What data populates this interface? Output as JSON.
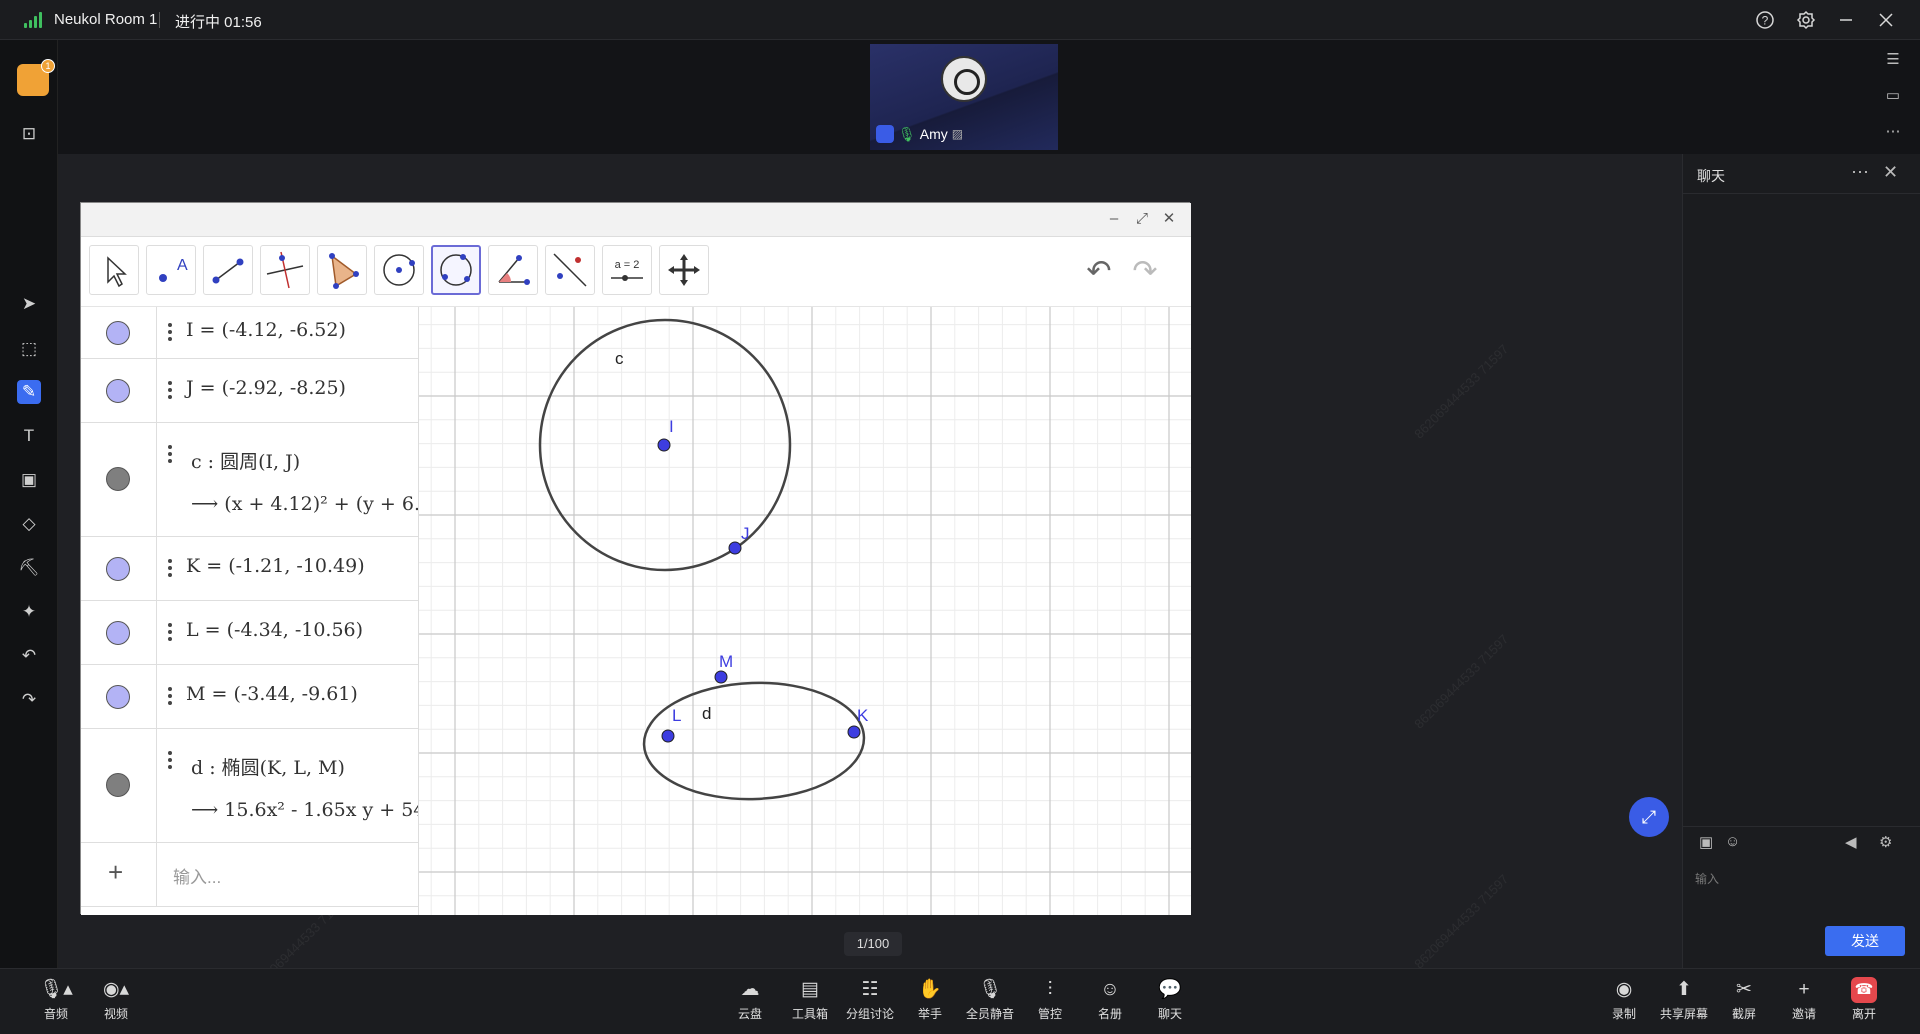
{
  "titlebar": {
    "room": "Neukol Room 1",
    "status": "进行中 01:56",
    "help_icon": "question-circle-icon",
    "settings_icon": "gear-icon",
    "minimize_icon": "minimize-icon",
    "close_icon": "close-icon"
  },
  "video": {
    "participant": "Amy"
  },
  "notice_badge": "1",
  "geogebra": {
    "tools": [
      "move-tool",
      "point-tool",
      "segment-tool",
      "perpendicular-line-tool",
      "polygon-tool",
      "circle-center-tool",
      "conic-through-points-tool",
      "angle-tool",
      "reflect-tool",
      "slider-tool",
      "move-view-tool"
    ],
    "slider_label": "a = 2",
    "algebra": [
      {
        "type": "point",
        "text": "I = (-4.12, -6.52)"
      },
      {
        "type": "point",
        "text": "J = (-2.92, -8.25)"
      },
      {
        "type": "conic",
        "text": "c : 圆周(I, J)",
        "output": "(x + 4.12)² + (y + 6.5"
      },
      {
        "type": "point",
        "text": "K = (-1.21, -10.49)"
      },
      {
        "type": "point",
        "text": "L = (-4.34, -10.56)"
      },
      {
        "type": "point",
        "text": "M = (-3.44, -9.61)"
      },
      {
        "type": "conic",
        "text": "d : 椭圆(K, L, M)",
        "output": "15.6x² - 1.65x y + 54.("
      }
    ],
    "input_placeholder": "输入...",
    "graph_labels": {
      "c": "c",
      "I": "I",
      "J": "J",
      "M": "M",
      "L": "L",
      "K": "K",
      "d": "d"
    }
  },
  "pager": "1/100",
  "chat": {
    "title": "聊天",
    "placeholder": "输入",
    "send": "发送"
  },
  "bottombar": {
    "left": [
      {
        "label": "音频",
        "icon": "microphone-icon"
      },
      {
        "label": "视频",
        "icon": "camera-icon"
      }
    ],
    "center": [
      {
        "label": "云盘",
        "icon": "cloud-icon"
      },
      {
        "label": "工具箱",
        "icon": "toolbox-icon"
      },
      {
        "label": "分组讨论",
        "icon": "group-icon"
      },
      {
        "label": "举手",
        "icon": "raise-hand-icon"
      },
      {
        "label": "全员静音",
        "icon": "mute-all-icon"
      },
      {
        "label": "管控",
        "icon": "controls-icon"
      },
      {
        "label": "名册",
        "icon": "roster-icon"
      },
      {
        "label": "聊天",
        "icon": "chat-icon"
      }
    ],
    "right": [
      {
        "label": "录制",
        "icon": "record-icon"
      },
      {
        "label": "共享屏幕",
        "icon": "share-screen-icon"
      },
      {
        "label": "截屏",
        "icon": "scissors-icon"
      },
      {
        "label": "邀请",
        "icon": "plus-icon"
      },
      {
        "label": "离开",
        "icon": "hang-up-icon"
      }
    ]
  }
}
